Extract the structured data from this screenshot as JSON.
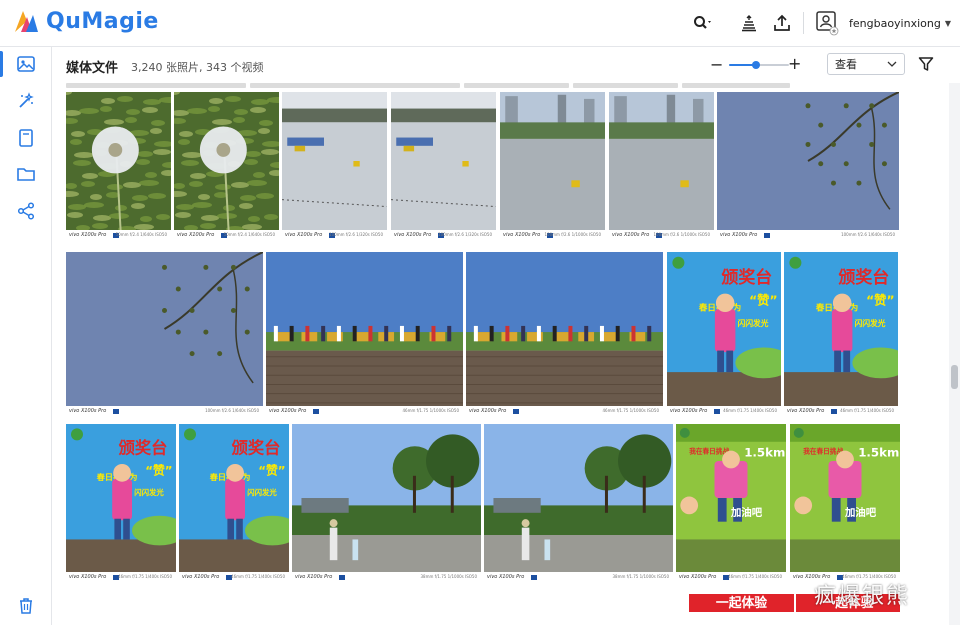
{
  "app": {
    "brand": "QuMagie"
  },
  "header": {
    "user": "fengbaoyinxiong"
  },
  "toolbar": {
    "title": "媒体文件",
    "subtitle": "3,240 张照片, 343 个视频",
    "zoom_level": 0.45,
    "view_label": "查看"
  },
  "sidebar": {
    "items": [
      {
        "icon": "photos-icon",
        "active": true
      },
      {
        "icon": "magic-wand-icon",
        "active": false
      },
      {
        "icon": "album-icon",
        "active": false
      },
      {
        "icon": "folder-icon",
        "active": false
      },
      {
        "icon": "share-icon",
        "active": false
      }
    ],
    "bottom_icon": "trash-icon"
  },
  "colors": {
    "accent": "#2a7be4",
    "zeiss": "#1c4fa0"
  },
  "photos": {
    "row1": [
      {
        "kind": "dandelion",
        "brand": "vivo X100s Pro",
        "spec": "50mm f/2.4 1/640s ISO50"
      },
      {
        "kind": "dandelion",
        "brand": "vivo X100s Pro",
        "spec": "50mm f/2.4 1/640s ISO50"
      },
      {
        "kind": "lake-boats",
        "brand": "vivo X100s Pro",
        "spec": "100mm f/2.6 1/320s ISO50"
      },
      {
        "kind": "lake-boats",
        "brand": "vivo X100s Pro",
        "spec": "100mm f/2.6 1/320s ISO50"
      },
      {
        "kind": "lake-city",
        "brand": "vivo X100s Pro",
        "spec": "100mm f/2.6 1/1000s ISO50"
      },
      {
        "kind": "lake-city",
        "brand": "vivo X100s Pro",
        "spec": "100mm f/2.6 1/1000s ISO50"
      },
      {
        "kind": "sky-branch",
        "brand": "vivo X100s Pro",
        "spec": "100mm f/2.6 1/640s ISO50"
      }
    ],
    "row2": [
      {
        "kind": "sky-branch",
        "brand": "vivo X100s Pro",
        "spec": "100mm f/2.6 1/640s ISO50"
      },
      {
        "kind": "playground",
        "brand": "vivo X100s Pro",
        "spec": "46mm f/1.75 1/1000s ISO50"
      },
      {
        "kind": "playground",
        "brand": "vivo X100s Pro",
        "spec": "46mm f/1.75 1/1000s ISO50"
      },
      {
        "kind": "poster-blue",
        "brand": "vivo X100s Pro",
        "spec": "46mm f/1.75 1/400s ISO50"
      },
      {
        "kind": "poster-blue",
        "brand": "vivo X100s Pro",
        "spec": "46mm f/1.75 1/400s ISO50"
      }
    ],
    "row3": [
      {
        "kind": "poster-blue",
        "brand": "vivo X100s Pro",
        "spec": "46mm f/1.75 1/400s ISO50"
      },
      {
        "kind": "poster-blue",
        "brand": "vivo X100s Pro",
        "spec": "46mm f/1.75 1/400s ISO50"
      },
      {
        "kind": "park-walk",
        "brand": "vivo X100s Pro",
        "spec": "38mm f/1.75 1/1000s ISO50"
      },
      {
        "kind": "park-walk",
        "brand": "vivo X100s Pro",
        "spec": "38mm f/1.75 1/1000s ISO50"
      },
      {
        "kind": "poster-green",
        "brand": "vivo X100s Pro",
        "spec": "46mm f/1.75 1/400s ISO50"
      },
      {
        "kind": "poster-green",
        "brand": "vivo X100s Pro",
        "spec": "46mm f/1.75 1/400s ISO50"
      }
    ]
  },
  "poster_blue": {
    "title": "颁奖台",
    "line1": "春日挑战为",
    "line2": "“赞”",
    "line3": "闪闪发光"
  },
  "poster_green": {
    "title": "我在春日挑战",
    "distance": "1.5km",
    "cheer": "加油吧"
  },
  "poster_red": {
    "text": "一起体验"
  },
  "watermark": "疯爆银熊"
}
